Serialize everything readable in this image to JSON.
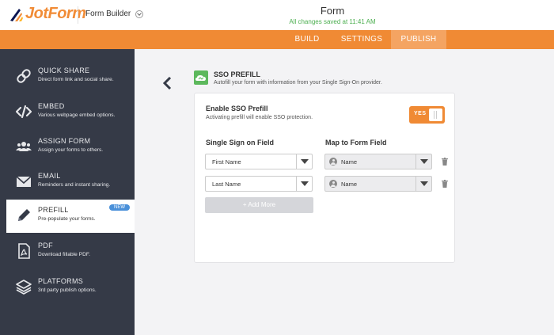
{
  "brand": {
    "name": "JotForm",
    "accent": "#f08a34"
  },
  "header": {
    "builder_label": "Form Builder",
    "title": "Form",
    "status": "All changes saved at 11:41 AM"
  },
  "nav": {
    "tabs": [
      {
        "label": "BUILD"
      },
      {
        "label": "SETTINGS"
      },
      {
        "label": "PUBLISH",
        "active": true
      }
    ]
  },
  "sidebar": {
    "items": [
      {
        "title": "QUICK SHARE",
        "subtitle": "Direct form link and social share.",
        "icon": "link-icon"
      },
      {
        "title": "EMBED",
        "subtitle": "Various webpage embed options.",
        "icon": "code-icon"
      },
      {
        "title": "ASSIGN FORM",
        "subtitle": "Assign your forms to others.",
        "icon": "users-icon"
      },
      {
        "title": "EMAIL",
        "subtitle": "Reminders and instant sharing.",
        "icon": "envelope-icon"
      },
      {
        "title": "PREFILL",
        "subtitle": "Pre-populate your forms.",
        "icon": "pencil-icon",
        "active": true,
        "badge": "NEW"
      },
      {
        "title": "PDF",
        "subtitle": "Download fillable PDF.",
        "icon": "pdf-icon"
      },
      {
        "title": "PLATFORMS",
        "subtitle": "3rd party publish options.",
        "icon": "layers-icon"
      }
    ]
  },
  "main": {
    "section_title": "SSO PREFILL",
    "section_desc": "Autofill your form with information from your Single Sign-On provider.",
    "enable": {
      "title": "Enable SSO Prefill",
      "desc": "Activating prefill will enable SSO protection.",
      "toggle_label": "YES",
      "on": true
    },
    "col_sso": "Single Sign on Field",
    "col_map": "Map to Form Field",
    "rows": [
      {
        "sso": "First Name",
        "field": "Name"
      },
      {
        "sso": "Last Name",
        "field": "Name"
      }
    ],
    "add_more": "+ Add More"
  }
}
